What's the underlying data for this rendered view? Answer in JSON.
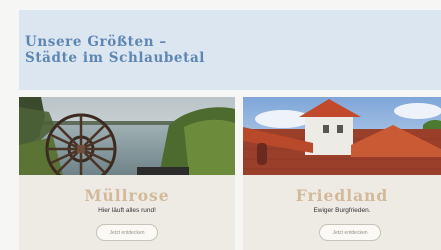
{
  "banner": {
    "title": "Unsere Größten –\nStädte im Schlaubetal"
  },
  "cards": [
    {
      "city": "Müllrose",
      "slogan": "Hier läuft alles rund!",
      "button": "Jetzt entdecken",
      "image": "water-wheel-lake-photo"
    },
    {
      "city": "Friedland",
      "slogan": "Ewiger Burgfrieden.",
      "button": "Jetzt entdecken",
      "image": "castle-tower-photo"
    }
  ]
}
